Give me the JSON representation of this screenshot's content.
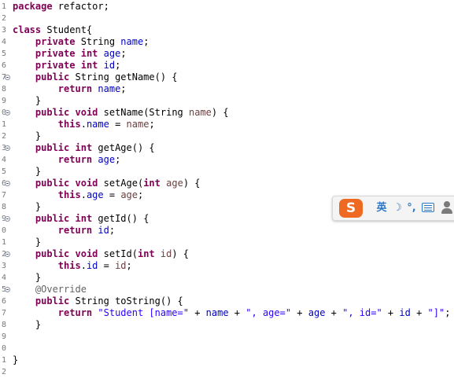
{
  "editor": {
    "lines": [
      {
        "num": "1",
        "fold": false,
        "tokens": [
          {
            "t": "package",
            "c": "kw"
          },
          {
            "t": " refactor;",
            "c": ""
          }
        ]
      },
      {
        "num": "2",
        "fold": false,
        "tokens": []
      },
      {
        "num": "3",
        "fold": false,
        "tokens": [
          {
            "t": "class",
            "c": "kw"
          },
          {
            "t": " Student{",
            "c": ""
          }
        ]
      },
      {
        "num": "4",
        "fold": false,
        "tokens": [
          {
            "t": "    ",
            "c": ""
          },
          {
            "t": "private",
            "c": "kw"
          },
          {
            "t": " String ",
            "c": ""
          },
          {
            "t": "name",
            "c": "fld"
          },
          {
            "t": ";",
            "c": ""
          }
        ]
      },
      {
        "num": "5",
        "fold": false,
        "tokens": [
          {
            "t": "    ",
            "c": ""
          },
          {
            "t": "private",
            "c": "kw"
          },
          {
            "t": " ",
            "c": ""
          },
          {
            "t": "int",
            "c": "kw"
          },
          {
            "t": " ",
            "c": ""
          },
          {
            "t": "age",
            "c": "fld"
          },
          {
            "t": ";",
            "c": ""
          }
        ]
      },
      {
        "num": "6",
        "fold": false,
        "tokens": [
          {
            "t": "    ",
            "c": ""
          },
          {
            "t": "private",
            "c": "kw"
          },
          {
            "t": " ",
            "c": ""
          },
          {
            "t": "int",
            "c": "kw"
          },
          {
            "t": " ",
            "c": ""
          },
          {
            "t": "id",
            "c": "fld"
          },
          {
            "t": ";",
            "c": ""
          }
        ]
      },
      {
        "num": "7",
        "fold": true,
        "tokens": [
          {
            "t": "    ",
            "c": ""
          },
          {
            "t": "public",
            "c": "kw"
          },
          {
            "t": " String getName() {",
            "c": ""
          }
        ]
      },
      {
        "num": "8",
        "fold": false,
        "tokens": [
          {
            "t": "        ",
            "c": ""
          },
          {
            "t": "return",
            "c": "kw"
          },
          {
            "t": " ",
            "c": ""
          },
          {
            "t": "name",
            "c": "fld"
          },
          {
            "t": ";",
            "c": ""
          }
        ]
      },
      {
        "num": "9",
        "fold": false,
        "tokens": [
          {
            "t": "    }",
            "c": ""
          }
        ]
      },
      {
        "num": "0",
        "fold": true,
        "tokens": [
          {
            "t": "    ",
            "c": ""
          },
          {
            "t": "public",
            "c": "kw"
          },
          {
            "t": " ",
            "c": ""
          },
          {
            "t": "void",
            "c": "kw"
          },
          {
            "t": " setName(String ",
            "c": ""
          },
          {
            "t": "name",
            "c": "par"
          },
          {
            "t": ") {",
            "c": ""
          }
        ]
      },
      {
        "num": "1",
        "fold": false,
        "tokens": [
          {
            "t": "        ",
            "c": ""
          },
          {
            "t": "this",
            "c": "kw"
          },
          {
            "t": ".",
            "c": ""
          },
          {
            "t": "name",
            "c": "fld"
          },
          {
            "t": " = ",
            "c": ""
          },
          {
            "t": "name",
            "c": "par"
          },
          {
            "t": ";",
            "c": ""
          }
        ]
      },
      {
        "num": "2",
        "fold": false,
        "tokens": [
          {
            "t": "    }",
            "c": ""
          }
        ]
      },
      {
        "num": "3",
        "fold": true,
        "tokens": [
          {
            "t": "    ",
            "c": ""
          },
          {
            "t": "public",
            "c": "kw"
          },
          {
            "t": " ",
            "c": ""
          },
          {
            "t": "int",
            "c": "kw"
          },
          {
            "t": " getAge() {",
            "c": ""
          }
        ]
      },
      {
        "num": "4",
        "fold": false,
        "tokens": [
          {
            "t": "        ",
            "c": ""
          },
          {
            "t": "return",
            "c": "kw"
          },
          {
            "t": " ",
            "c": ""
          },
          {
            "t": "age",
            "c": "fld"
          },
          {
            "t": ";",
            "c": ""
          }
        ]
      },
      {
        "num": "5",
        "fold": false,
        "tokens": [
          {
            "t": "    }",
            "c": ""
          }
        ]
      },
      {
        "num": "6",
        "fold": true,
        "tokens": [
          {
            "t": "    ",
            "c": ""
          },
          {
            "t": "public",
            "c": "kw"
          },
          {
            "t": " ",
            "c": ""
          },
          {
            "t": "void",
            "c": "kw"
          },
          {
            "t": " setAge(",
            "c": ""
          },
          {
            "t": "int",
            "c": "kw"
          },
          {
            "t": " ",
            "c": ""
          },
          {
            "t": "age",
            "c": "par"
          },
          {
            "t": ") {",
            "c": ""
          }
        ]
      },
      {
        "num": "7",
        "fold": false,
        "tokens": [
          {
            "t": "        ",
            "c": ""
          },
          {
            "t": "this",
            "c": "kw"
          },
          {
            "t": ".",
            "c": ""
          },
          {
            "t": "age",
            "c": "fld"
          },
          {
            "t": " = ",
            "c": ""
          },
          {
            "t": "age",
            "c": "par"
          },
          {
            "t": ";",
            "c": ""
          }
        ]
      },
      {
        "num": "8",
        "fold": false,
        "tokens": [
          {
            "t": "    }",
            "c": ""
          }
        ]
      },
      {
        "num": "9",
        "fold": true,
        "tokens": [
          {
            "t": "    ",
            "c": ""
          },
          {
            "t": "public",
            "c": "kw"
          },
          {
            "t": " ",
            "c": ""
          },
          {
            "t": "int",
            "c": "kw"
          },
          {
            "t": " getId() {",
            "c": ""
          }
        ]
      },
      {
        "num": "0",
        "fold": false,
        "tokens": [
          {
            "t": "        ",
            "c": ""
          },
          {
            "t": "return",
            "c": "kw"
          },
          {
            "t": " ",
            "c": ""
          },
          {
            "t": "id",
            "c": "fld"
          },
          {
            "t": ";",
            "c": ""
          }
        ]
      },
      {
        "num": "1",
        "fold": false,
        "tokens": [
          {
            "t": "    }",
            "c": ""
          }
        ]
      },
      {
        "num": "2",
        "fold": true,
        "tokens": [
          {
            "t": "    ",
            "c": ""
          },
          {
            "t": "public",
            "c": "kw"
          },
          {
            "t": " ",
            "c": ""
          },
          {
            "t": "void",
            "c": "kw"
          },
          {
            "t": " setId(",
            "c": ""
          },
          {
            "t": "int",
            "c": "kw"
          },
          {
            "t": " ",
            "c": ""
          },
          {
            "t": "id",
            "c": "par"
          },
          {
            "t": ") {",
            "c": ""
          }
        ]
      },
      {
        "num": "3",
        "fold": false,
        "tokens": [
          {
            "t": "        ",
            "c": ""
          },
          {
            "t": "this",
            "c": "kw"
          },
          {
            "t": ".",
            "c": ""
          },
          {
            "t": "id",
            "c": "fld"
          },
          {
            "t": " = ",
            "c": ""
          },
          {
            "t": "id",
            "c": "par"
          },
          {
            "t": ";",
            "c": ""
          }
        ]
      },
      {
        "num": "4",
        "fold": false,
        "tokens": [
          {
            "t": "    }",
            "c": ""
          }
        ]
      },
      {
        "num": "5",
        "fold": true,
        "tokens": [
          {
            "t": "    ",
            "c": ""
          },
          {
            "t": "@Override",
            "c": "ann"
          }
        ]
      },
      {
        "num": "6",
        "fold": false,
        "tokens": [
          {
            "t": "    ",
            "c": ""
          },
          {
            "t": "public",
            "c": "kw"
          },
          {
            "t": " String toString() {",
            "c": ""
          }
        ]
      },
      {
        "num": "7",
        "fold": false,
        "tokens": [
          {
            "t": "        ",
            "c": ""
          },
          {
            "t": "return",
            "c": "kw"
          },
          {
            "t": " ",
            "c": ""
          },
          {
            "t": "\"Student [name=\"",
            "c": "str"
          },
          {
            "t": " + ",
            "c": ""
          },
          {
            "t": "name",
            "c": "fld"
          },
          {
            "t": " + ",
            "c": ""
          },
          {
            "t": "\", age=\"",
            "c": "str"
          },
          {
            "t": " + ",
            "c": ""
          },
          {
            "t": "age",
            "c": "fld"
          },
          {
            "t": " + ",
            "c": ""
          },
          {
            "t": "\", id=\"",
            "c": "str"
          },
          {
            "t": " + ",
            "c": ""
          },
          {
            "t": "id",
            "c": "fld"
          },
          {
            "t": " + ",
            "c": ""
          },
          {
            "t": "\"]\"",
            "c": "str"
          },
          {
            "t": ";",
            "c": ""
          }
        ]
      },
      {
        "num": "8",
        "fold": false,
        "tokens": [
          {
            "t": "    }",
            "c": ""
          }
        ]
      },
      {
        "num": "9",
        "fold": false,
        "tokens": []
      },
      {
        "num": "0",
        "fold": false,
        "tokens": []
      },
      {
        "num": "1",
        "fold": false,
        "tokens": [
          {
            "t": "}",
            "c": ""
          }
        ]
      },
      {
        "num": "2",
        "fold": false,
        "tokens": []
      }
    ]
  },
  "ime": {
    "logo": "S",
    "lang": "英",
    "moon_icon": "moon-icon",
    "punct": "°,",
    "keyboard_icon": "keyboard-icon",
    "user_icon": "user-icon"
  }
}
